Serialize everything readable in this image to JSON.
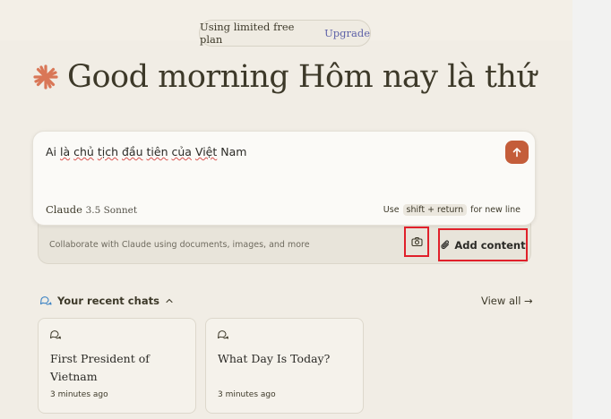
{
  "plan": {
    "text": "Using limited free plan",
    "upgrade": "Upgrade"
  },
  "greeting": "Good morning Hôm nay là thứ",
  "input": {
    "prompt_parts": [
      "Ai ",
      "là",
      " ",
      "chủ",
      " ",
      "tịch",
      " ",
      "đầu",
      " ",
      "tiên",
      " ",
      "của",
      " ",
      "Việt",
      " Nam"
    ],
    "model_name": "Claude",
    "model_version": "3.5 Sonnet",
    "hint_use": "Use",
    "hint_key": "shift + return",
    "hint_rest": "for new line"
  },
  "attach": {
    "hint": "Collaborate with Claude using documents, images, and more",
    "add_content": "Add content"
  },
  "recent": {
    "header": "Your recent chats",
    "view_all": "View all →",
    "chats": [
      {
        "title": "First President of Vietnam",
        "time": "3 minutes ago"
      },
      {
        "title": "What Day Is Today?",
        "time": "3 minutes ago"
      }
    ]
  },
  "colors": {
    "accent": "#c45d3a",
    "highlight": "#e0202a",
    "link": "#5e62a8",
    "icon_blue": "#3b82c4"
  },
  "icons": [
    "claude-star-icon",
    "arrow-up-icon",
    "camera-icon",
    "paperclip-icon",
    "chat-bubbles-icon",
    "chevron-up-icon",
    "chat-bubble-icon"
  ]
}
